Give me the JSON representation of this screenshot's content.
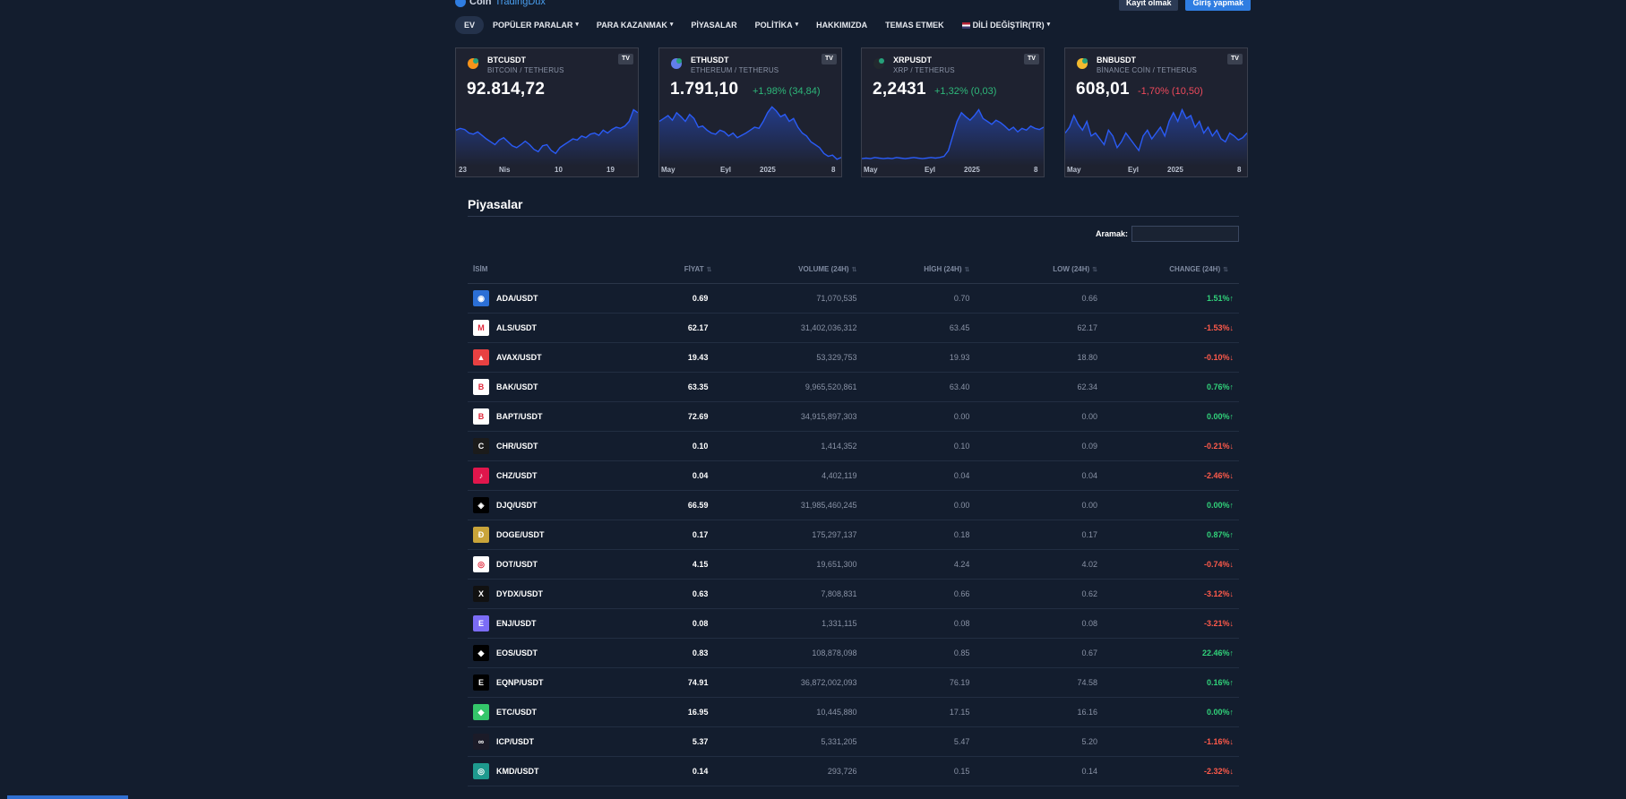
{
  "header": {
    "logo_text": "Coin",
    "logo_text2": "TradingDux",
    "register_label": "Kayıt olmak",
    "login_label": "Giriş yapmak"
  },
  "nav": [
    {
      "label": "EV",
      "caret": false,
      "active": true
    },
    {
      "label": "POPÜLER PARALAR",
      "caret": true
    },
    {
      "label": "PARA KAZANMAK",
      "caret": true
    },
    {
      "label": "PİYASALAR",
      "caret": false
    },
    {
      "label": "POLİTİKA",
      "caret": true
    },
    {
      "label": "HAKKIMIZDA",
      "caret": false
    },
    {
      "label": "TEMAS ETMEK",
      "caret": false
    },
    {
      "label": "DİLİ DEĞİŞTİR(TR)",
      "caret": true,
      "flag": true
    }
  ],
  "widgets": [
    {
      "symbol": "BTCUSDT",
      "pair": "BITCOIN / TETHERUS",
      "price": "92.814,72",
      "change": "",
      "dir": "none",
      "coin_color": "#f7931a",
      "ticks": [
        "23",
        "Nis",
        "10",
        "19"
      ],
      "series": [
        0.55,
        0.58,
        0.56,
        0.5,
        0.48,
        0.52,
        0.46,
        0.4,
        0.35,
        0.3,
        0.38,
        0.42,
        0.35,
        0.28,
        0.25,
        0.3,
        0.36,
        0.3,
        0.22,
        0.18,
        0.28,
        0.3,
        0.2,
        0.15,
        0.25,
        0.3,
        0.35,
        0.4,
        0.38,
        0.45,
        0.42,
        0.48,
        0.5,
        0.46,
        0.55,
        0.5,
        0.56,
        0.6,
        0.58,
        0.62,
        0.7,
        0.9,
        0.85
      ]
    },
    {
      "symbol": "ETHUSDT",
      "pair": "ETHEREUM / TETHERUS",
      "price": "1.791,10",
      "change": "+1,98% (34,84)",
      "dir": "up",
      "coin_color": "#627eea",
      "ticks": [
        "May",
        "Eyl",
        "2025",
        "8"
      ],
      "series": [
        0.7,
        0.75,
        0.8,
        0.72,
        0.85,
        0.78,
        0.7,
        0.82,
        0.75,
        0.6,
        0.62,
        0.55,
        0.5,
        0.48,
        0.55,
        0.52,
        0.45,
        0.5,
        0.42,
        0.46,
        0.5,
        0.55,
        0.6,
        0.58,
        0.7,
        0.85,
        0.95,
        0.88,
        0.78,
        0.82,
        0.7,
        0.75,
        0.6,
        0.5,
        0.45,
        0.35,
        0.3,
        0.25,
        0.15,
        0.1,
        0.12,
        0.05,
        0.08
      ]
    },
    {
      "symbol": "XRPUSDT",
      "pair": "XRP / TETHERUS",
      "price": "2,2431",
      "change": "+1,32% (0,03)",
      "dir": "up",
      "coin_color": "#23292f",
      "ticks": [
        "May",
        "Eyl",
        "2025",
        "8"
      ],
      "series": [
        0.06,
        0.07,
        0.06,
        0.08,
        0.07,
        0.06,
        0.07,
        0.06,
        0.08,
        0.07,
        0.06,
        0.07,
        0.08,
        0.07,
        0.06,
        0.07,
        0.08,
        0.07,
        0.08,
        0.1,
        0.2,
        0.45,
        0.7,
        0.85,
        0.78,
        0.72,
        0.8,
        0.9,
        0.75,
        0.7,
        0.65,
        0.72,
        0.68,
        0.62,
        0.55,
        0.6,
        0.52,
        0.58,
        0.55,
        0.62,
        0.58,
        0.56,
        0.6
      ]
    },
    {
      "symbol": "BNBUSDT",
      "pair": "BİNANCE COİN / TETHERUS",
      "price": "608,01",
      "change": "-1,70% (10,50)",
      "dir": "down",
      "coin_color": "#f3ba2f",
      "ticks": [
        "May",
        "Eyl",
        "2025",
        "8"
      ],
      "series": [
        0.5,
        0.6,
        0.8,
        0.65,
        0.55,
        0.7,
        0.45,
        0.5,
        0.4,
        0.3,
        0.55,
        0.45,
        0.25,
        0.35,
        0.5,
        0.4,
        0.3,
        0.2,
        0.45,
        0.55,
        0.4,
        0.5,
        0.6,
        0.45,
        0.7,
        0.85,
        0.7,
        0.9,
        0.75,
        0.8,
        0.6,
        0.7,
        0.5,
        0.6,
        0.45,
        0.55,
        0.4,
        0.35,
        0.5,
        0.45,
        0.38,
        0.42,
        0.5
      ]
    }
  ],
  "markets": {
    "title": "Piyasalar",
    "search_label": "Aramak:",
    "columns": [
      "İSİM",
      "FİYAT",
      "VOLUME (24H)",
      "HİGH (24H)",
      "LOW (24H)",
      "CHANGE (24H)"
    ],
    "rows": [
      {
        "name": "ADA/USDT",
        "price": "0.69",
        "volume": "71,070,535",
        "high": "0.70",
        "low": "0.66",
        "change": "1.51%",
        "dir": "up",
        "icon_bg": "#2b6fd6",
        "icon": "◉"
      },
      {
        "name": "ALS/USDT",
        "price": "62.17",
        "volume": "31,402,036,312",
        "high": "63.45",
        "low": "62.17",
        "change": "-1.53%",
        "dir": "down",
        "icon_bg": "#ffffff",
        "icon": "M"
      },
      {
        "name": "AVAX/USDT",
        "price": "19.43",
        "volume": "53,329,753",
        "high": "19.93",
        "low": "18.80",
        "change": "-0.10%",
        "dir": "down",
        "icon_bg": "#e84142",
        "icon": "▲"
      },
      {
        "name": "BAK/USDT",
        "price": "63.35",
        "volume": "9,965,520,861",
        "high": "63.40",
        "low": "62.34",
        "change": "0.76%",
        "dir": "up",
        "icon_bg": "#ffffff",
        "icon": "B"
      },
      {
        "name": "BAPT/USDT",
        "price": "72.69",
        "volume": "34,915,897,303",
        "high": "0.00",
        "low": "0.00",
        "change": "0.00%",
        "dir": "up",
        "icon_bg": "#ffffff",
        "icon": "B"
      },
      {
        "name": "CHR/USDT",
        "price": "0.10",
        "volume": "1,414,352",
        "high": "0.10",
        "low": "0.09",
        "change": "-0.21%",
        "dir": "down",
        "icon_bg": "#1b1b1b",
        "icon": "C"
      },
      {
        "name": "CHZ/USDT",
        "price": "0.04",
        "volume": "4,402,119",
        "high": "0.04",
        "low": "0.04",
        "change": "-2.46%",
        "dir": "down",
        "icon_bg": "#e0164c",
        "icon": "♪"
      },
      {
        "name": "DJQ/USDT",
        "price": "66.59",
        "volume": "31,985,460,245",
        "high": "0.00",
        "low": "0.00",
        "change": "0.00%",
        "dir": "up",
        "icon_bg": "#000000",
        "icon": "◈"
      },
      {
        "name": "DOGE/USDT",
        "price": "0.17",
        "volume": "175,297,137",
        "high": "0.18",
        "low": "0.17",
        "change": "0.87%",
        "dir": "up",
        "icon_bg": "#c9a43a",
        "icon": "Ð"
      },
      {
        "name": "DOT/USDT",
        "price": "4.15",
        "volume": "19,651,300",
        "high": "4.24",
        "low": "4.02",
        "change": "-0.74%",
        "dir": "down",
        "icon_bg": "#ffffff",
        "icon": "◎"
      },
      {
        "name": "DYDX/USDT",
        "price": "0.63",
        "volume": "7,808,831",
        "high": "0.66",
        "low": "0.62",
        "change": "-3.12%",
        "dir": "down",
        "icon_bg": "#111111",
        "icon": "X"
      },
      {
        "name": "ENJ/USDT",
        "price": "0.08",
        "volume": "1,331,115",
        "high": "0.08",
        "low": "0.08",
        "change": "-3.21%",
        "dir": "down",
        "icon_bg": "#7b6cf6",
        "icon": "E"
      },
      {
        "name": "EOS/USDT",
        "price": "0.83",
        "volume": "108,878,098",
        "high": "0.85",
        "low": "0.67",
        "change": "22.46%",
        "dir": "up",
        "icon_bg": "#000000",
        "icon": "◆"
      },
      {
        "name": "EQNP/USDT",
        "price": "74.91",
        "volume": "36,872,002,093",
        "high": "76.19",
        "low": "74.58",
        "change": "0.16%",
        "dir": "up",
        "icon_bg": "#000000",
        "icon": "E"
      },
      {
        "name": "ETC/USDT",
        "price": "16.95",
        "volume": "10,445,880",
        "high": "17.15",
        "low": "16.16",
        "change": "0.00%",
        "dir": "up",
        "icon_bg": "#34c66a",
        "icon": "◆"
      },
      {
        "name": "ICP/USDT",
        "price": "5.37",
        "volume": "5,331,205",
        "high": "5.47",
        "low": "5.20",
        "change": "-1.16%",
        "dir": "down",
        "icon_bg": "#1b1b28",
        "icon": "∞"
      },
      {
        "name": "KMD/USDT",
        "price": "0.14",
        "volume": "293,726",
        "high": "0.15",
        "low": "0.14",
        "change": "-2.32%",
        "dir": "down",
        "icon_bg": "#1e9a8e",
        "icon": "◎"
      }
    ]
  },
  "colors": {
    "up": "#31d27a",
    "down": "#ff5a4a",
    "accent": "#2f7de1",
    "line": "#2a5bf5"
  }
}
